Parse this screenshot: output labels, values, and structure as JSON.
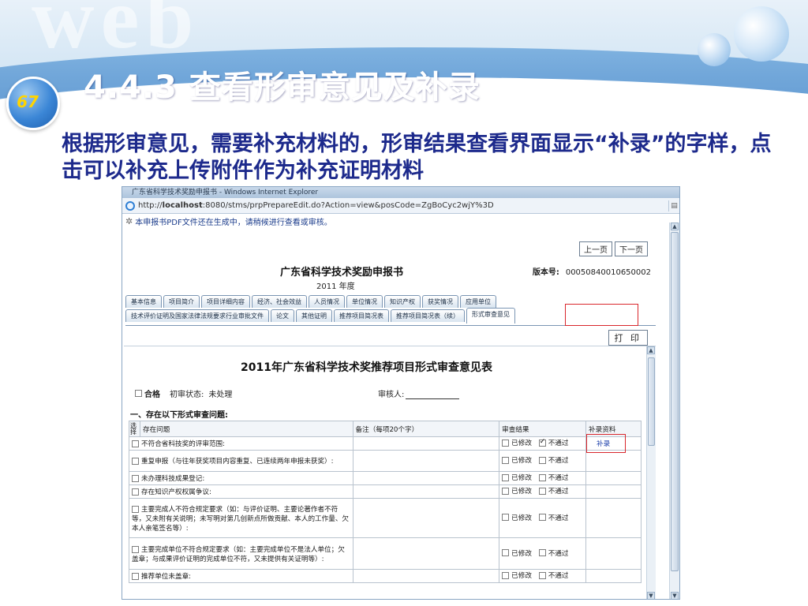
{
  "slide": {
    "page_number": "67",
    "title": "4.4.3 查看形审意见及补录",
    "description": "根据形审意见，需要补充材料的，形审结果查看界面显示“补录”的字样，点击可以补充上传附件作为补充证明材料"
  },
  "browser": {
    "window_title": "广东省科学技术奖励申报书 - Windows Internet Explorer",
    "url_prefix": "http://",
    "url_host": "localhost",
    "url_rest": ":8080/stms/prpPrepareEdit.do?Action=view&posCode=ZgBoCyc2wjY%3D",
    "notice": "本申报书PDF文件还在生成中，请稍候进行查看或审核。"
  },
  "report": {
    "prev_label": "上一页",
    "next_label": "下一页",
    "title": "广东省科学技术奖励申报书",
    "year": "2011 年度",
    "number_label": "版本号:",
    "number_value": "00050840010650002",
    "tabs_row1": [
      "基本信息",
      "项目简介",
      "项目详细内容",
      "经济、社会效益",
      "人员情况",
      "单位情况",
      "知识产权",
      "获奖情况",
      "应用单位"
    ],
    "tabs_row2": [
      "技术评价证明及国家法律法规要求行业审批文件",
      "论文",
      "其他证明",
      "推荐项目简况表",
      "推荐项目简况表（续）",
      "形式审查意见"
    ],
    "print_label": "打 印"
  },
  "form": {
    "title": "2011年广东省科学技术奖推荐项目形式审查意见表",
    "pass_label": "合格",
    "initial_status_label": "初审状态:",
    "initial_status_value": "未处理",
    "auditor_label": "审核人:",
    "section_heading": "一、存在以下形式审查问题:",
    "columns": {
      "select": "选择",
      "issue": "存在问题",
      "note": "备注（每项20个字）",
      "result": "审查结果",
      "supplement": "补录资料"
    },
    "option_modified": "已修改",
    "option_failed": "不通过",
    "rows": [
      {
        "issue": "不符合省科技奖的评审范围:",
        "failed_checked": true,
        "supplement": "补录"
      },
      {
        "issue": "重复申报（与往年获奖项目内容重复、已连续两年申报未获奖）:",
        "failed_checked": false,
        "supplement": ""
      },
      {
        "issue": "未办理科技成果登记:",
        "failed_checked": false,
        "supplement": ""
      },
      {
        "issue": "存在知识产权权属争议:",
        "failed_checked": false,
        "supplement": ""
      },
      {
        "issue": "主要完成人不符合规定要求（如：与评价证明、主要论著作者不符等，又未附有关说明；未写明对第几创新点所做贡献、本人的工作量、欠本人亲笔签名等）:",
        "failed_checked": false,
        "supplement": ""
      },
      {
        "issue": "主要完成单位不符合规定要求（如：主要完成单位不是法人单位；欠盖章；与成果评价证明的完成单位不符，又未提供有关证明等）:",
        "failed_checked": false,
        "supplement": ""
      },
      {
        "issue": "推荐单位未盖章:",
        "failed_checked": false,
        "supplement": ""
      }
    ]
  }
}
